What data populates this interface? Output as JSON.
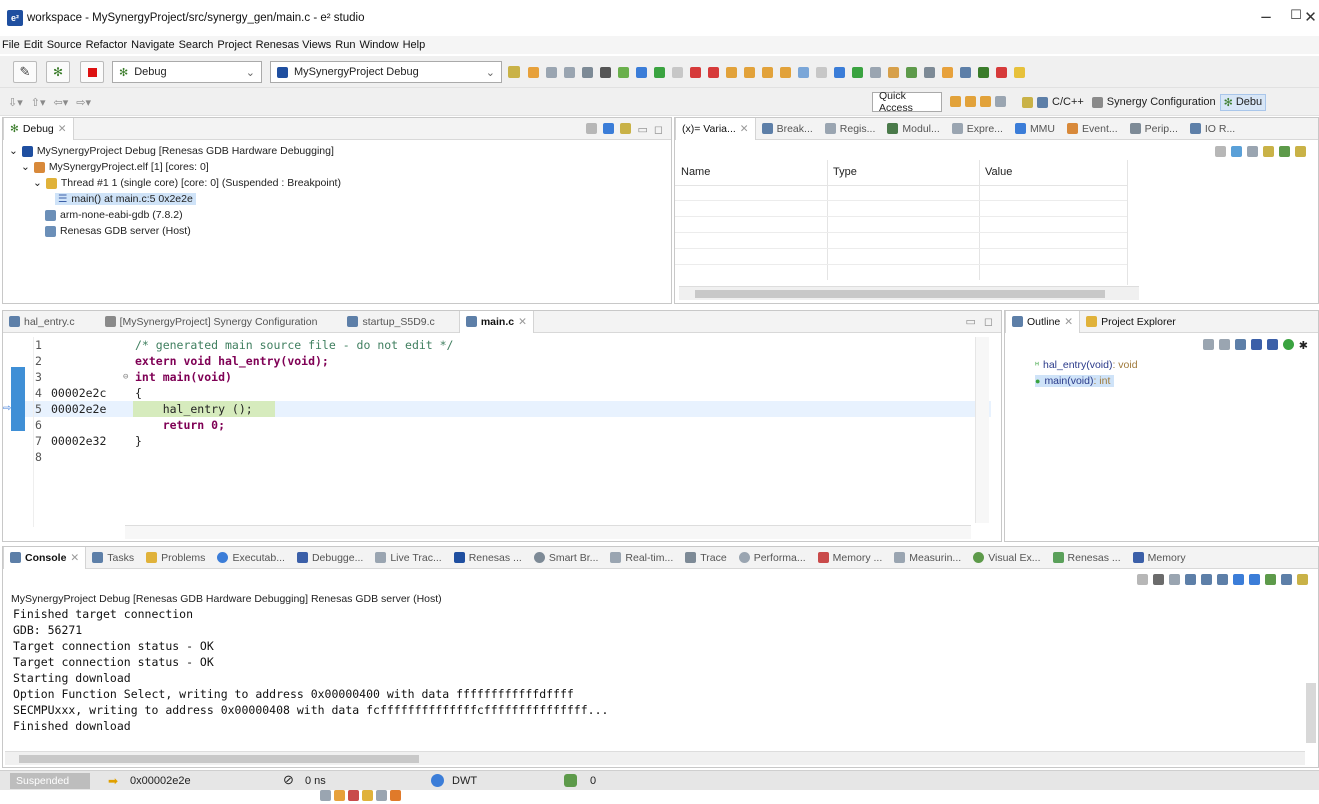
{
  "window": {
    "title": "workspace - MySynergyProject/src/synergy_gen/main.c - e² studio",
    "app_icon": "e²",
    "minimize": "−",
    "maximize": "☐",
    "close": "✕"
  },
  "menu": [
    "File",
    "Edit",
    "Source",
    "Refactor",
    "Navigate",
    "Search",
    "Project",
    "Renesas Views",
    "Run",
    "Window",
    "Help"
  ],
  "toolbar": {
    "build_config": "Debug",
    "launch_config": "MySynergyProject Debug",
    "quick_access": "Quick Access",
    "perspective_cpp": "C/C++",
    "perspective_synergy": "Synergy Configuration",
    "perspective_debug": "Debu"
  },
  "debug_view": {
    "tab_label": "Debug",
    "items": [
      "MySynergyProject Debug [Renesas GDB Hardware Debugging]",
      "MySynergyProject.elf [1] [cores: 0]",
      "Thread #1 1 (single core) [core: 0] (Suspended : Breakpoint)",
      "main() at main.c:5 0x2e2e",
      "arm-none-eabi-gdb (7.8.2)",
      "Renesas GDB server (Host)"
    ]
  },
  "variables_view": {
    "tabs": [
      "(x)= Varia...",
      "Break...",
      "Regis...",
      "Modul...",
      "Expre...",
      "MMU",
      "Event...",
      "Perip...",
      "IO R..."
    ],
    "columns": [
      "Name",
      "Type",
      "Value"
    ]
  },
  "editor": {
    "tabs": [
      "hal_entry.c",
      "[MySynergyProject] Synergy Configuration",
      "startup_S5D9.c",
      "main.c"
    ],
    "lines": [
      {
        "num": "1",
        "addr": "",
        "code": "/* generated main source file - do not edit */",
        "kind": "comment"
      },
      {
        "num": "2",
        "addr": "",
        "code": "extern void hal_entry(void);",
        "kind": "extern"
      },
      {
        "num": "3",
        "addr": "",
        "code": "int main(void)",
        "kind": "int"
      },
      {
        "num": "4",
        "addr": "00002e2c",
        "code": "{",
        "kind": "plain"
      },
      {
        "num": "5",
        "addr": "00002e2e",
        "code": "    hal_entry ();",
        "kind": "plain"
      },
      {
        "num": "6",
        "addr": "",
        "code": "    return 0;",
        "kind": "return"
      },
      {
        "num": "7",
        "addr": "00002e32",
        "code": "}",
        "kind": "plain"
      },
      {
        "num": "8",
        "addr": "",
        "code": "",
        "kind": "plain"
      }
    ]
  },
  "outline": {
    "tabs": [
      "Outline",
      "Project Explorer"
    ],
    "items": [
      {
        "name": "hal_entry(void)",
        "type": " : void"
      },
      {
        "name": "main(void)",
        "type": " : int"
      }
    ]
  },
  "console": {
    "tabs": [
      "Console",
      "Tasks",
      "Problems",
      "Executab...",
      "Debugge...",
      "Live Trac...",
      "Renesas ...",
      "Smart Br...",
      "Real-tim...",
      "Trace",
      "Performa...",
      "Memory ...",
      "Measurin...",
      "Visual Ex...",
      "Renesas ...",
      "Memory"
    ],
    "header": "MySynergyProject Debug [Renesas GDB Hardware Debugging] Renesas GDB server (Host)",
    "lines": [
      "Finished target connection",
      "GDB: 56271",
      "Target connection status - OK",
      "Target connection status - OK",
      "Starting download",
      "Option Function Select, writing to address 0x00000400 with data ffffffffffffdffff",
      "SECMPUxxx, writing to address 0x00000408 with data fcffffffffffffffcfffffffffffffff...",
      "Finished download"
    ]
  },
  "status": {
    "state": "Suspended",
    "pc": "0x00002e2e",
    "time": "0 ns",
    "dwt": "DWT",
    "count": "0"
  }
}
